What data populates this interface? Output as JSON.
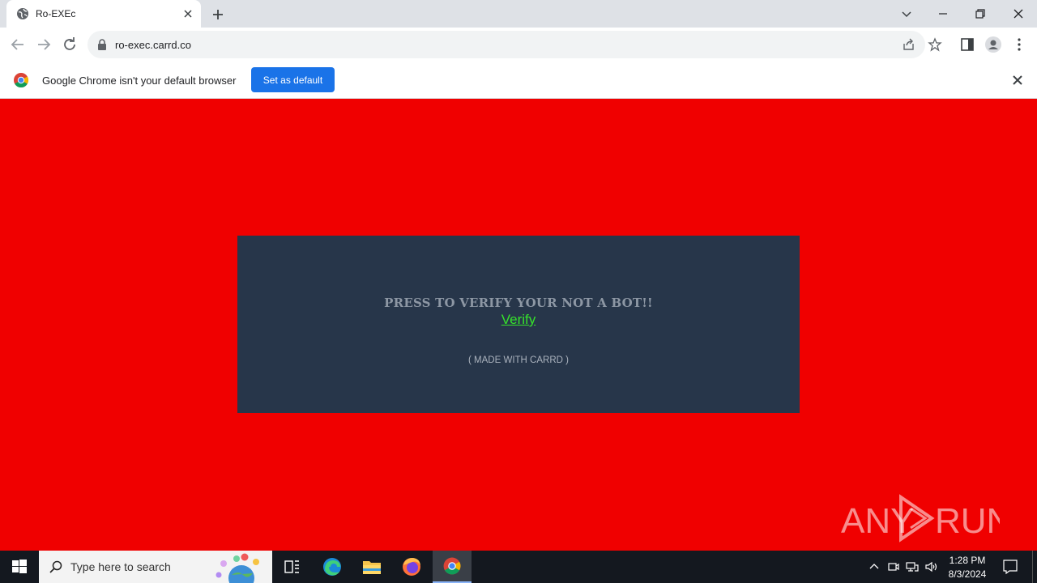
{
  "browser": {
    "tab": {
      "title": "Ro-EXEc"
    },
    "address_bar": {
      "url": "ro-exec.carrd.co"
    },
    "infobar": {
      "message": "Google Chrome isn't your default browser",
      "button_label": "Set as default"
    }
  },
  "page": {
    "background_color": "#f00000",
    "card_color": "#27364a",
    "headline": "PRESS TO VERIFY YOUR NOT A BOT!!",
    "verify_link": "Verify",
    "footer": "( MADE WITH CARRD )"
  },
  "watermark": {
    "text": "ANY RUN"
  },
  "taskbar": {
    "search_placeholder": "Type here to search",
    "clock_time": "1:28 PM",
    "clock_date": "8/3/2024",
    "pinned_apps": [
      "task-view-icon",
      "edge-icon",
      "file-explorer-icon",
      "firefox-icon",
      "chrome-icon"
    ]
  }
}
